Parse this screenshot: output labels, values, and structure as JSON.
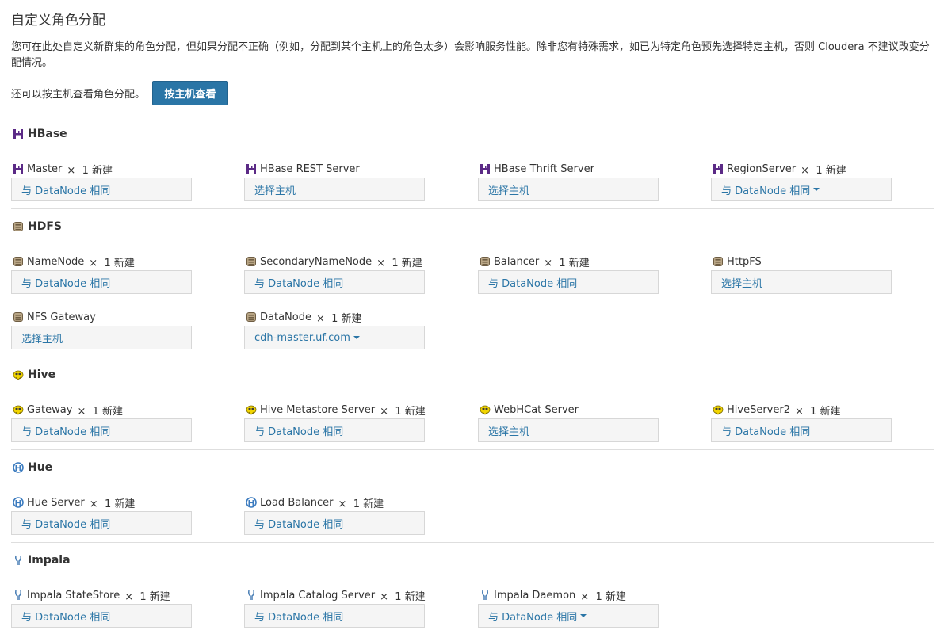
{
  "page": {
    "title": "自定义角色分配",
    "intro": "您可在此处自定义新群集的角色分配，但如果分配不正确（例如，分配到某个主机上的角色太多）会影响服务性能。除非您有特殊需求，如已为特定角色预先选择特定主机，否则 Cloudera 不建议改变分配情况。",
    "alt_text": "还可以按主机查看角色分配。",
    "view_by_host_button": "按主机查看"
  },
  "colors": {
    "link": "#2a75a6",
    "button_bg": "#2a75a6",
    "hbase": "#5b2a86",
    "hdfs": "#8a7658",
    "hive": "#e8c500",
    "hue": "#3b7bbf",
    "impala": "#4a7fb5"
  },
  "services": {
    "hbase": {
      "name": "HBase",
      "icon": "hbase-icon",
      "roles": [
        {
          "name": "Master",
          "count": "1 新建",
          "hosts": "与 DataNode 相同",
          "dropdown": false
        },
        {
          "name": "HBase REST Server",
          "count": "",
          "hosts": "选择主机",
          "dropdown": false
        },
        {
          "name": "HBase Thrift Server",
          "count": "",
          "hosts": "选择主机",
          "dropdown": false
        },
        {
          "name": "RegionServer",
          "count": "1 新建",
          "hosts": "与 DataNode 相同",
          "dropdown": true
        }
      ]
    },
    "hdfs": {
      "name": "HDFS",
      "icon": "hdfs-icon",
      "roles": [
        {
          "name": "NameNode",
          "count": "1 新建",
          "hosts": "与 DataNode 相同",
          "dropdown": false
        },
        {
          "name": "SecondaryNameNode",
          "count": "1 新建",
          "hosts": "与 DataNode 相同",
          "dropdown": false
        },
        {
          "name": "Balancer",
          "count": "1 新建",
          "hosts": "与 DataNode 相同",
          "dropdown": false
        },
        {
          "name": "HttpFS",
          "count": "",
          "hosts": "选择主机",
          "dropdown": false
        },
        {
          "name": "NFS Gateway",
          "count": "",
          "hosts": "选择主机",
          "dropdown": false
        },
        {
          "name": "DataNode",
          "count": "1 新建",
          "hosts": "cdh-master.uf.com",
          "dropdown": true
        }
      ]
    },
    "hive": {
      "name": "Hive",
      "icon": "hive-icon",
      "roles": [
        {
          "name": "Gateway",
          "count": "1 新建",
          "hosts": "与 DataNode 相同",
          "dropdown": false
        },
        {
          "name": "Hive Metastore Server",
          "count": "1 新建",
          "hosts": "与 DataNode 相同",
          "dropdown": false
        },
        {
          "name": "WebHCat Server",
          "count": "",
          "hosts": "选择主机",
          "dropdown": false
        },
        {
          "name": "HiveServer2",
          "count": "1 新建",
          "hosts": "与 DataNode 相同",
          "dropdown": false
        }
      ]
    },
    "hue": {
      "name": "Hue",
      "icon": "hue-icon",
      "roles": [
        {
          "name": "Hue Server",
          "count": "1 新建",
          "hosts": "与 DataNode 相同",
          "dropdown": false
        },
        {
          "name": "Load Balancer",
          "count": "1 新建",
          "hosts": "与 DataNode 相同",
          "dropdown": false
        }
      ]
    },
    "impala": {
      "name": "Impala",
      "icon": "impala-icon",
      "roles": [
        {
          "name": "Impala StateStore",
          "count": "1 新建",
          "hosts": "与 DataNode 相同",
          "dropdown": false
        },
        {
          "name": "Impala Catalog Server",
          "count": "1 新建",
          "hosts": "与 DataNode 相同",
          "dropdown": false
        },
        {
          "name": "Impala Daemon",
          "count": "1 新建",
          "hosts": "与 DataNode 相同",
          "dropdown": true
        }
      ]
    }
  }
}
